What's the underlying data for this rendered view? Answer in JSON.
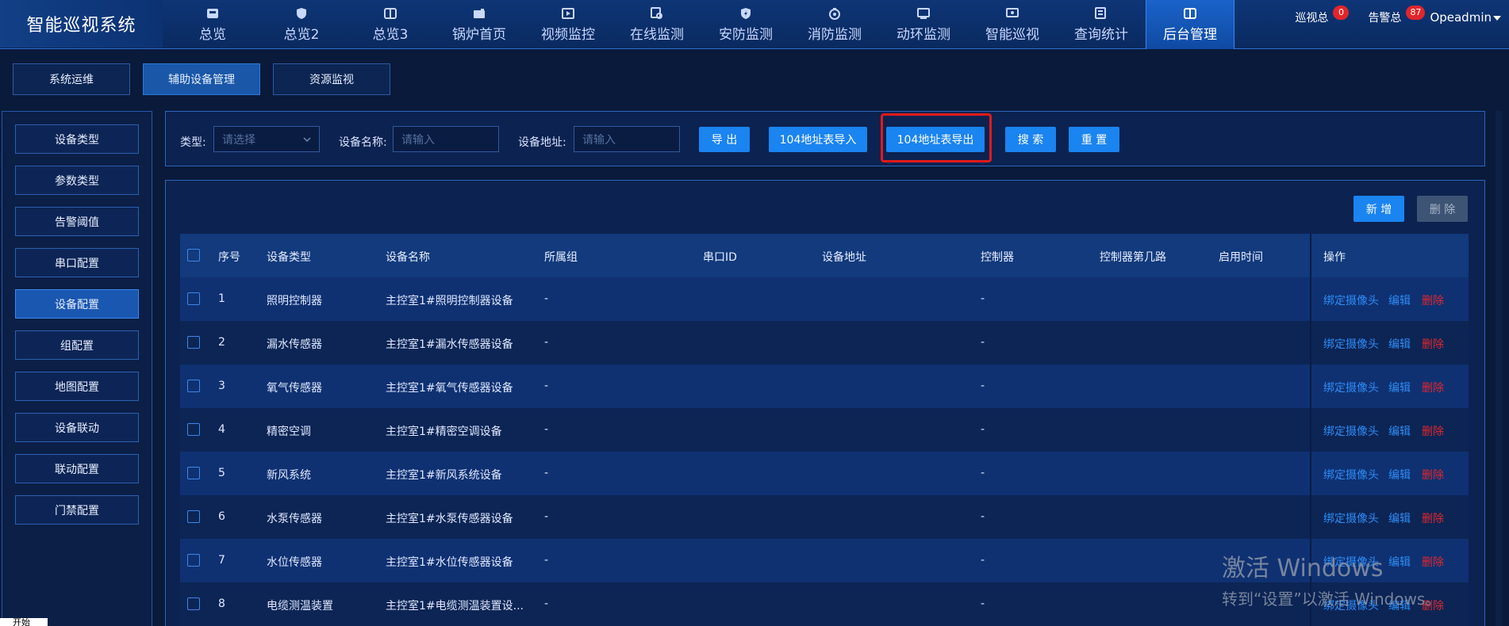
{
  "app": {
    "title": "智能巡视系统"
  },
  "nav": [
    {
      "label": "总览",
      "icon": "dashboard-icon"
    },
    {
      "label": "总览2",
      "icon": "shield-icon"
    },
    {
      "label": "总览3",
      "icon": "book-icon"
    },
    {
      "label": "锅炉首页",
      "icon": "boiler-icon"
    },
    {
      "label": "视频监控",
      "icon": "video-icon"
    },
    {
      "label": "在线监测",
      "icon": "monitor-search-icon"
    },
    {
      "label": "安防监测",
      "icon": "security-icon"
    },
    {
      "label": "消防监测",
      "icon": "fire-icon"
    },
    {
      "label": "动环监测",
      "icon": "env-icon"
    },
    {
      "label": "智能巡视",
      "icon": "patrol-icon"
    },
    {
      "label": "查询统计",
      "icon": "stats-icon"
    },
    {
      "label": "后台管理",
      "icon": "admin-icon"
    }
  ],
  "header_right": {
    "patrol_label": "巡视总",
    "patrol_count": "0",
    "alarm_label": "告警总",
    "alarm_count": "87",
    "user": "Opeadmin"
  },
  "subtabs": [
    "系统运维",
    "辅助设备管理",
    "资源监视"
  ],
  "sidebar": [
    "设备类型",
    "参数类型",
    "告警阈值",
    "串口配置",
    "设备配置",
    "组配置",
    "地图配置",
    "设备联动",
    "联动配置",
    "门禁配置"
  ],
  "filter": {
    "type_label": "类型:",
    "type_placeholder": "请选择",
    "name_label": "设备名称:",
    "name_placeholder": "请输入",
    "addr_label": "设备地址:",
    "addr_placeholder": "请输入",
    "export": "导 出",
    "import104": "104地址表导入",
    "export104": "104地址表导出",
    "search": "搜 索",
    "reset": "重 置"
  },
  "toolbar": {
    "add": "新 增",
    "delete": "删 除"
  },
  "table": {
    "headers": [
      "序号",
      "设备类型",
      "设备名称",
      "所属组",
      "串口ID",
      "设备地址",
      "控制器",
      "控制器第几路",
      "启用时间",
      "操作"
    ],
    "op_bind": "绑定摄像头",
    "op_edit": "编辑",
    "op_delete": "删除",
    "rows": [
      {
        "no": "1",
        "type": "照明控制器",
        "name": "主控室1#照明控制器设备",
        "group": "-",
        "controller": "-"
      },
      {
        "no": "2",
        "type": "漏水传感器",
        "name": "主控室1#漏水传感器设备",
        "group": "-",
        "controller": "-"
      },
      {
        "no": "3",
        "type": "氧气传感器",
        "name": "主控室1#氧气传感器设备",
        "group": "-",
        "controller": "-"
      },
      {
        "no": "4",
        "type": "精密空调",
        "name": "主控室1#精密空调设备",
        "group": "-",
        "controller": "-"
      },
      {
        "no": "5",
        "type": "新风系统",
        "name": "主控室1#新风系统设备",
        "group": "-",
        "controller": "-"
      },
      {
        "no": "6",
        "type": "水泵传感器",
        "name": "主控室1#水泵传感器设备",
        "group": "-",
        "controller": "-"
      },
      {
        "no": "7",
        "type": "水位传感器",
        "name": "主控室1#水位传感器设备",
        "group": "-",
        "controller": "-"
      },
      {
        "no": "8",
        "type": "电缆测温装置",
        "name": "主控室1#电缆测温装置设...",
        "group": "-",
        "controller": "-"
      }
    ]
  },
  "watermark": {
    "line1": "激活 Windows",
    "line2": "转到“设置”以激活 Windows。"
  },
  "corner_tip": "开始"
}
